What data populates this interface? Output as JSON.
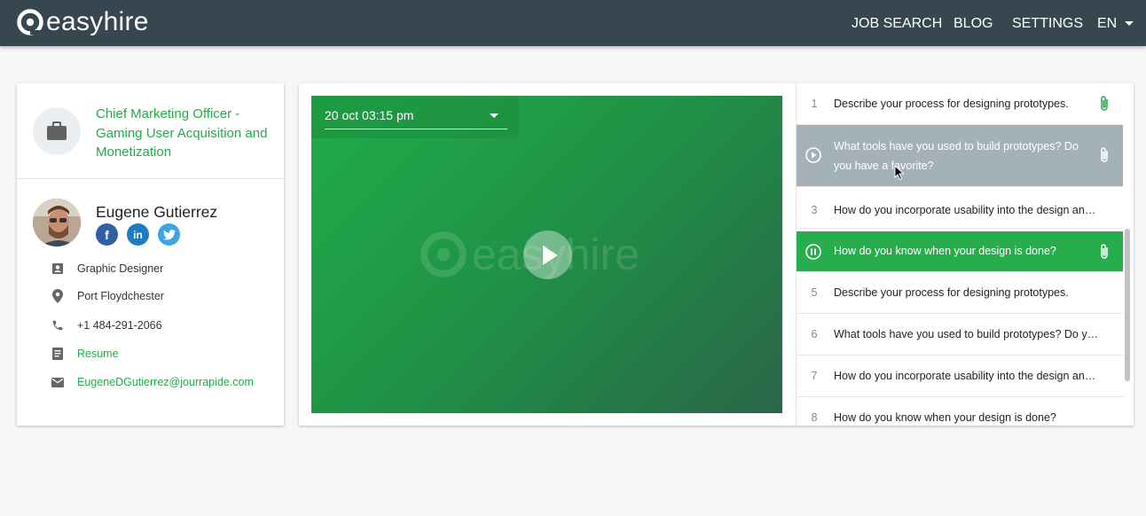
{
  "header": {
    "logo_text": "easyhire",
    "nav": [
      "JOB SEARCH",
      "BLOG",
      "SETTINGS"
    ],
    "language": "EN"
  },
  "job": {
    "title": "Chief Marketing Officer - Gaming User Acquisition and Monetization"
  },
  "candidate": {
    "name": "Eugene Gutierrez",
    "socials": [
      "facebook-icon",
      "linkedin-icon",
      "twitter-icon"
    ],
    "details": [
      {
        "icon": "contact-card-icon",
        "text": "Graphic Designer",
        "link": false
      },
      {
        "icon": "location-pin-icon",
        "text": "Port Floydchester",
        "link": false
      },
      {
        "icon": "phone-icon",
        "text": "+1 484-291-2066",
        "link": false
      },
      {
        "icon": "document-icon",
        "text": "Resume",
        "link": true
      },
      {
        "icon": "email-icon",
        "text": "EugeneDGutierrez@jourrapide.com",
        "link": true
      }
    ]
  },
  "video": {
    "date": "20 oct 03:15 pm",
    "watermark": "easyhire"
  },
  "questions": [
    {
      "num": "1",
      "text": "Describe your process for designing prototypes.",
      "state": "normal",
      "attachment": true
    },
    {
      "num": "",
      "text": "What tools have you used to build prototypes? Do you have a favorite?",
      "state": "hover",
      "attachment": true
    },
    {
      "num": "3",
      "text": "How do you incorporate usability into the design and…",
      "state": "normal",
      "attachment": false
    },
    {
      "num": "",
      "text": "How do you know when your design is done?",
      "state": "playing",
      "attachment": true
    },
    {
      "num": "5",
      "text": "Describe your process for designing prototypes.",
      "state": "normal",
      "attachment": false
    },
    {
      "num": "6",
      "text": "What tools have you used to build prototypes? Do you…",
      "state": "normal",
      "attachment": false
    },
    {
      "num": "7",
      "text": "How do you incorporate usability into the design and…",
      "state": "normal",
      "attachment": false
    },
    {
      "num": "8",
      "text": "How do you know when your design is done?",
      "state": "normal",
      "attachment": false
    }
  ],
  "colors": {
    "header_bg": "#37474f",
    "accent_green": "#26a84a",
    "hover_gray": "#a4b1b9"
  }
}
